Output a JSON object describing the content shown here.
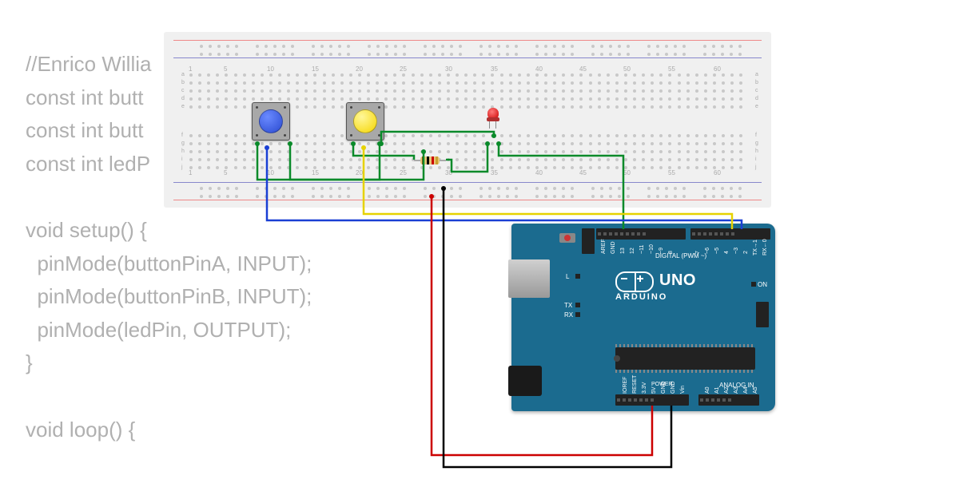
{
  "code_lines": [
    "//Enrico Willia",
    "const int butt",
    "const int butt",
    "const int ledP",
    "",
    "void setup() {",
    "  pinMode(buttonPinA, INPUT);",
    "  pinMode(buttonPinB, INPUT);",
    "  pinMode(ledPin, OUTPUT);",
    "}",
    "",
    "void loop() {"
  ],
  "breadboard": {
    "col_numbers": [
      "1",
      "5",
      "10",
      "15",
      "20",
      "25",
      "30",
      "35",
      "40",
      "45",
      "50",
      "55",
      "60"
    ],
    "row_labels_top": [
      "a",
      "b",
      "c",
      "d",
      "e"
    ],
    "row_labels_bot": [
      "f",
      "g",
      "h",
      "i",
      "j"
    ]
  },
  "components": {
    "button_blue": {
      "color": "#2a4ad0"
    },
    "button_yellow": {
      "color": "#f5d500"
    },
    "led_red": {
      "color": "red"
    },
    "resistor": {
      "bands": [
        "#8b4513",
        "#000",
        "#c00",
        "#c9a030"
      ]
    }
  },
  "arduino": {
    "brand": "ARDUINO",
    "model": "UNO",
    "labels": {
      "tx": "TX",
      "rx": "RX",
      "on": "ON",
      "l": "L",
      "digital": "DIGITAL (PWM ~)",
      "analog": "ANALOG IN",
      "power": "POWER"
    },
    "digital_pins": [
      "AREF",
      "GND",
      "13",
      "12",
      "~11",
      "~10",
      "~9",
      "8",
      "",
      "7",
      "~6",
      "~5",
      "4",
      "~3",
      "2",
      "TX→1",
      "RX←0"
    ],
    "power_pins": [
      "IOREF",
      "RESET",
      "3.3V",
      "5V",
      "GND",
      "GND",
      "Vin"
    ],
    "analog_pins": [
      "A0",
      "A1",
      "A2",
      "A3",
      "A4",
      "A5"
    ]
  },
  "wires": [
    {
      "color": "#1a3fd4",
      "name": "blue-button-to-pin2"
    },
    {
      "color": "#e6d200",
      "name": "yellow-button-to-pin"
    },
    {
      "color": "#0a8a2a",
      "name": "green-led-to-pin13"
    },
    {
      "color": "#c00",
      "name": "5v-to-breadboard"
    },
    {
      "color": "#000",
      "name": "gnd-to-breadboard"
    }
  ]
}
